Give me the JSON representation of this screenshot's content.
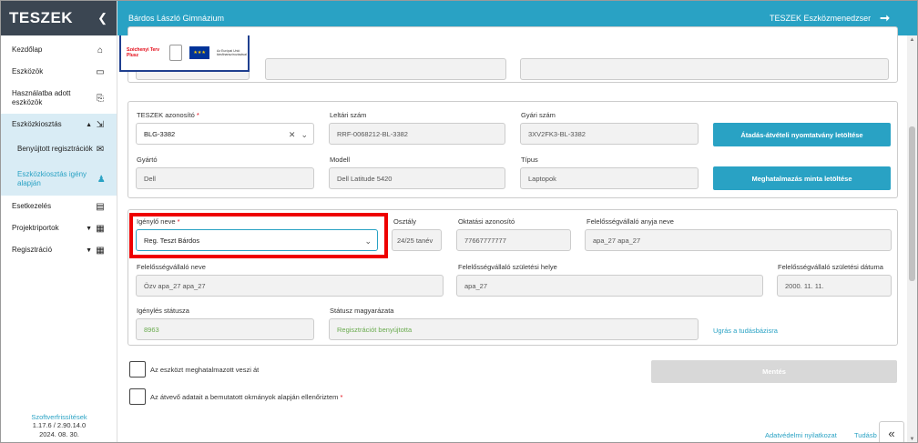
{
  "sidebar": {
    "logo": "TESZEK",
    "items": [
      {
        "label": "Kezdőlap",
        "icon": "⌂"
      },
      {
        "label": "Eszközök",
        "icon": "▭"
      },
      {
        "label": "Használatba adott eszközök",
        "icon": "⎘"
      },
      {
        "label": "Eszközkiosztás",
        "icon": "⇲"
      },
      {
        "label": "Benyújtott regisztrációk",
        "icon": "✉"
      },
      {
        "label": "Eszközkiosztás igény alapján",
        "icon": "♟"
      },
      {
        "label": "Esetkezelés",
        "icon": "▤"
      },
      {
        "label": "Projektriportok",
        "icon": "▦"
      },
      {
        "label": "Regisztráció",
        "icon": "▦"
      }
    ],
    "version_link": "Szoftverfrissítések",
    "version": "1.17.6 / 2.90.14.0",
    "version_date": "2024. 08. 30."
  },
  "header": {
    "school": "Bárdos László Gimnázium",
    "app": "TESZEK Eszközmenedzser"
  },
  "banner": {
    "program": "Széchenyi Terv Plusz",
    "eu_text": "Az Európai Unió társfinanszírozásával"
  },
  "device": {
    "teszek_id_label": "TESZEK azonosító",
    "teszek_id_value": "BLG-3382",
    "inventory_label": "Leltári szám",
    "inventory_value": "RRF-0068212-BL-3382",
    "serial_label": "Gyári szám",
    "serial_value": "3XV2FK3-BL-3382",
    "maker_label": "Gyártó",
    "maker_value": "Dell",
    "model_label": "Modell",
    "model_value": "Dell Latitude 5420",
    "type_label": "Típus",
    "type_value": "Laptopok",
    "btn_handover": "Átadás-átvételi nyomtatvány letöltése",
    "btn_authorization": "Meghatalmazás minta letöltése"
  },
  "requester": {
    "name_label": "Igénylő neve",
    "name_value": "Reg. Teszt Bárdos",
    "class_label": "Osztály",
    "class_value": "24/25 tanév",
    "edu_id_label": "Oktatási azonosító",
    "edu_id_value": "77667777777",
    "mother_label": "Felelősségvállaló anyja neve",
    "mother_value": "apa_27 apa_27",
    "guarantor_label": "Felelősségvállaló neve",
    "guarantor_value": "Özv apa_27 apa_27",
    "birthplace_label": "Felelősségvállaló születési helye",
    "birthplace_value": "apa_27",
    "birthdate_label": "Felelősségvállaló születési dátuma",
    "birthdate_value": "2000. 11. 11.",
    "status_label": "Igénylés státusza",
    "status_value": "8963",
    "status_desc_label": "Státusz magyarázata",
    "status_desc_value": "Regisztrációt benyújtotta",
    "kb_link": "Ugrás a tudásbázisra"
  },
  "checks": {
    "authorized": "Az eszközt meghatalmazott veszi át",
    "verified": "Az átvevő adatait a bemutatott okmányok alapján ellenőriztem"
  },
  "save_label": "Mentés",
  "footer": {
    "privacy": "Adatvédelmi nyilatkozat",
    "kb": "Tudásb"
  }
}
